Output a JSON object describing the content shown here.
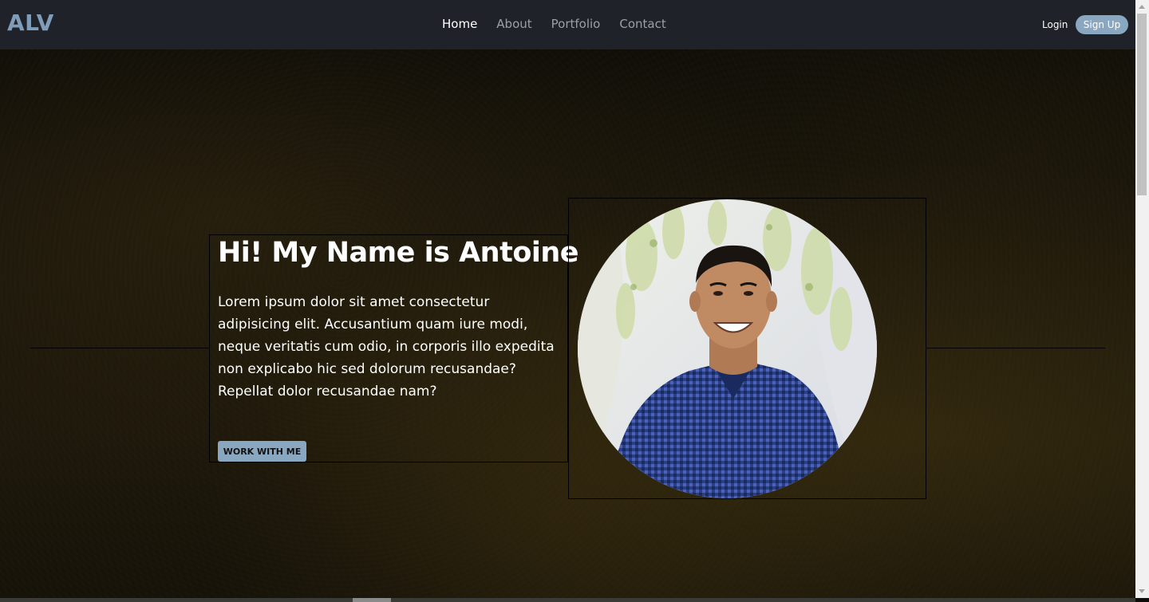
{
  "nav": {
    "brand": "ALV",
    "links": [
      {
        "label": "Home",
        "active": true
      },
      {
        "label": "About",
        "active": false
      },
      {
        "label": "Portfolio",
        "active": false
      },
      {
        "label": "Contact",
        "active": false
      }
    ],
    "login_label": "Login",
    "signup_label": "Sign Up"
  },
  "hero": {
    "title": "Hi! My Name is Antoine",
    "paragraph": "Lorem ipsum dolor sit amet consectetur adipisicing elit. Accusantium quam iure modi, neque veritatis cum odio, in corporis illo expedita non explicabo hic sed dolorum recusandae? Repellat dolor recusandae nam?",
    "cta_label": "WORK WITH ME"
  },
  "colors": {
    "navbar_bg": "#1f2329",
    "accent": "#8aa7c2",
    "brand": "#7f9db8"
  }
}
